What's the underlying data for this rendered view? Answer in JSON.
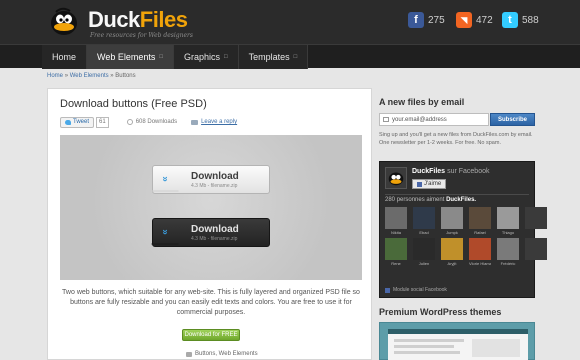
{
  "header": {
    "logo_duck": "Duck",
    "logo_files": "Files",
    "tagline": "Free resources for Web designers",
    "social": [
      {
        "icon": "facebook-icon",
        "glyph": "f",
        "count": "275",
        "color": "#3b5998"
      },
      {
        "icon": "rss-icon",
        "glyph": "◥",
        "count": "472",
        "color": "#f26522"
      },
      {
        "icon": "twitter-icon",
        "glyph": "t",
        "count": "588",
        "color": "#33ccff"
      }
    ]
  },
  "nav": {
    "home": "Home",
    "web_elements": "Web Elements",
    "graphics": "Graphics",
    "templates": "Templates",
    "arrow": "□"
  },
  "breadcrumb": {
    "home": "Home",
    "sep1": "»",
    "web_elements": "Web Elements",
    "sep2": "»",
    "current": "Buttons"
  },
  "post": {
    "title": "Download buttons (Free PSD)",
    "tweet_label": "Tweet",
    "tweet_count": "61",
    "downloads": "608 Downloads",
    "leave_reply": "Leave a reply",
    "preview": {
      "light": {
        "label": "Download",
        "info": "4.3 Mb - filename.zip"
      },
      "dark": {
        "label": "Download",
        "info": "4.3 Mb - filename.zip"
      },
      "chevron": "»"
    },
    "description": "Two web buttons, which suitable for any web-site. This is fully layered and organized PSD file so buttons are fully resizable and you can easily edit texts and colors. You are free to use it for commercial purposes.",
    "download_free": "Download for FREE",
    "tags": "Buttons, Web Elements"
  },
  "sidebar": {
    "email_heading": "A new files by email",
    "email_placeholder": "your.email@address",
    "subscribe": "Subscribe",
    "email_note": "Sing up and you'll get a new files from DuckFiles.com by email. One newsletter per 1-2 weeks. For free. No spam.",
    "facebook": {
      "page_name": "DuckFiles",
      "sur": "sur Facebook",
      "like": "J'aime",
      "count_number": "280",
      "count_text_pre": "personnes aiment",
      "count_text_post": "DuckFiles.",
      "fans": [
        {
          "name": "Nikita",
          "color": "#6b6b6b"
        },
        {
          "name": "Ebad",
          "color": "#2f3a4a"
        },
        {
          "name": "Jumpk",
          "color": "#8a8a8a"
        },
        {
          "name": "Rafael",
          "color": "#5a4a3a"
        },
        {
          "name": "Thiago",
          "color": "#9a9a9a"
        },
        {
          "name": "",
          "color": "#3a3a3a"
        },
        {
          "name": "Rene",
          "color": "#4a6a3a"
        },
        {
          "name": "Julien",
          "color": "#2a2a2a"
        },
        {
          "name": "Aryjit",
          "color": "#c0902a"
        },
        {
          "name": "Vlorie Hlama",
          "color": "#b04a2a"
        },
        {
          "name": "Frédéric",
          "color": "#7a7a7a"
        },
        {
          "name": "",
          "color": "#3a3a3a"
        }
      ],
      "plugin": "Module social Facebook"
    },
    "wp_heading": "Premium WordPress themes"
  }
}
